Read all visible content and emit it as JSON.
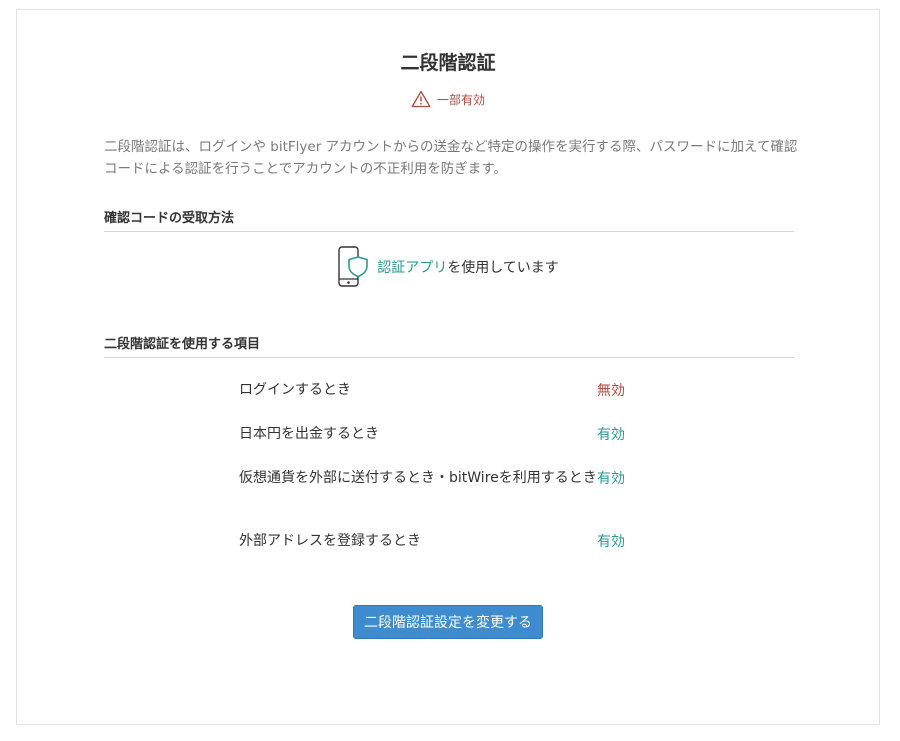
{
  "page": {
    "title": "二段階認証",
    "status_icon": "warning-triangle-icon",
    "status_text": "一部有効",
    "description": "二段階認証は、ログインや bitFlyer アカウントからの送金など特定の操作を実行する際、パスワードに加えて確認コードによる認証を行うことでアカウントの不正利用を防ぎます。"
  },
  "method_section": {
    "heading": "確認コードの受取方法",
    "icon": "phone-shield-icon",
    "link_text": "認証アプリ",
    "rest_text": "を使用しています"
  },
  "items_section": {
    "heading": "二段階認証を使用する項目",
    "items": [
      {
        "label": "ログインするとき",
        "state": "無効"
      },
      {
        "label": "日本円を出金するとき",
        "state": "有効"
      },
      {
        "label": "仮想通貨を外部に送付するとき・bitWireを利用するとき",
        "state": "有効"
      },
      {
        "label": "外部アドレスを登録するとき",
        "state": "有効"
      }
    ]
  },
  "actions": {
    "change_button": "二段階認証設定を変更する"
  },
  "colors": {
    "accent": "#2a9a8f",
    "warning": "#b04a41",
    "button": "#3d8ccf"
  }
}
